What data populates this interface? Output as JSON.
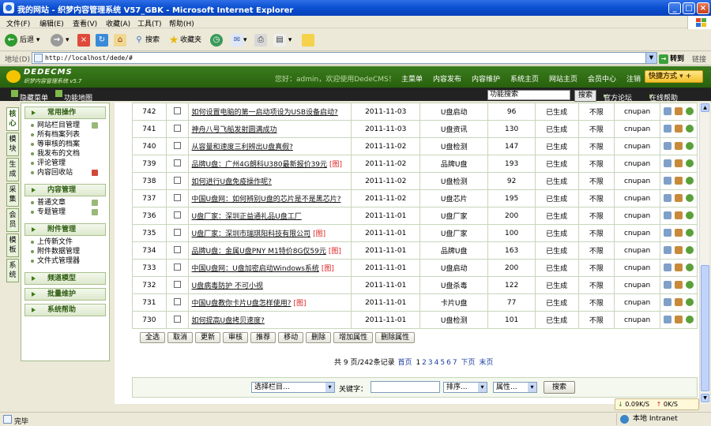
{
  "window": {
    "title": "我的网站 - 织梦内容管理系统 V57_GBK - Microsoft Internet Explorer",
    "min": "_",
    "max": "□",
    "close": "×"
  },
  "menu": [
    "文件(F)",
    "编辑(E)",
    "查看(V)",
    "收藏(A)",
    "工具(T)",
    "帮助(H)"
  ],
  "toolbar": {
    "back": "后退",
    "search": "搜索",
    "favorites": "收藏夹"
  },
  "address": {
    "label": "地址(D)",
    "url": "http://localhost/dede/#",
    "go": "转到",
    "links": "链接"
  },
  "header": {
    "logo": "DEDECMS",
    "logo_sub": "织梦内容管理系统 v5.7",
    "welcome": "您好：admin，欢迎使用DedeCMS！",
    "nav": [
      "主菜单",
      "内容发布",
      "内容维护",
      "系统主页",
      "网站主页",
      "会员中心",
      "注销"
    ],
    "quick": "快捷方式"
  },
  "subbar": {
    "hide_menu": "隐藏菜单",
    "sitemap": "功能地图",
    "search_value": "功能搜索",
    "search_button": "搜索",
    "forum": "官方论坛",
    "help": "在线帮助"
  },
  "side_tabs": [
    "核心",
    "模块",
    "生成",
    "采集",
    "会员",
    "模板",
    "系统"
  ],
  "side_menu": {
    "common": {
      "title": "常用操作",
      "items": [
        "网站栏目管理",
        "所有档案列表",
        "等审核的档案",
        "我发布的文档",
        "评论管理",
        "内容回收站"
      ]
    },
    "content": {
      "title": "内容管理",
      "items": [
        "普通文章",
        "专题管理"
      ]
    },
    "attach": {
      "title": "附件管理",
      "items": [
        "上传新文件",
        "附件数据管理",
        "文件式管理器"
      ]
    },
    "channel": {
      "title": "频道模型"
    },
    "batch": {
      "title": "批量维护"
    },
    "help": {
      "title": "系统帮助"
    }
  },
  "table": {
    "rows": [
      {
        "id": "742",
        "title": "如何设置电脑的第一启动项设为USB设备启动?",
        "img": "",
        "date": "2011-11-03",
        "category": "U盘启动",
        "clicks": "96",
        "status": "已生成",
        "flag": "不限",
        "author": "cnupan"
      },
      {
        "id": "741",
        "title": "神舟八号飞船发射圆满成功",
        "img": "",
        "date": "2011-11-03",
        "category": "U盘资讯",
        "clicks": "130",
        "status": "已生成",
        "flag": "不限",
        "author": "cnupan"
      },
      {
        "id": "740",
        "title": "从容量和速度三利辨出U盘真假?",
        "img": "",
        "date": "2011-11-02",
        "category": "U盘检测",
        "clicks": "147",
        "status": "已生成",
        "flag": "不限",
        "author": "cnupan"
      },
      {
        "id": "739",
        "title": "品牌U盘：广州4G朗科U380最新报价39元",
        "img": "[图]",
        "date": "2011-11-02",
        "category": "品牌U盘",
        "clicks": "193",
        "status": "已生成",
        "flag": "不限",
        "author": "cnupan"
      },
      {
        "id": "738",
        "title": "如何进行U盘免疫操作呢?",
        "img": "",
        "date": "2011-11-02",
        "category": "U盘检测",
        "clicks": "92",
        "status": "已生成",
        "flag": "不限",
        "author": "cnupan"
      },
      {
        "id": "737",
        "title": "中国U盘网：如何辨别U盘的芯片是不是黑芯片?",
        "img": "",
        "date": "2011-11-02",
        "category": "U盘芯片",
        "clicks": "195",
        "status": "已生成",
        "flag": "不限",
        "author": "cnupan"
      },
      {
        "id": "736",
        "title": "U盘厂家：深圳正益通礼品U盘工厂",
        "img": "",
        "date": "2011-11-01",
        "category": "U盘厂家",
        "clicks": "200",
        "status": "已生成",
        "flag": "不限",
        "author": "cnupan"
      },
      {
        "id": "735",
        "title": "U盘厂家：深圳市瑞琪阳科技有限公司",
        "img": "[图]",
        "date": "2011-11-01",
        "category": "U盘厂家",
        "clicks": "100",
        "status": "已生成",
        "flag": "不限",
        "author": "cnupan"
      },
      {
        "id": "734",
        "title": "品牌U盘：金属U盘PNY M1特价8G仅59元",
        "img": "[图]",
        "date": "2011-11-01",
        "category": "品牌U盘",
        "clicks": "163",
        "status": "已生成",
        "flag": "不限",
        "author": "cnupan"
      },
      {
        "id": "733",
        "title": "中国U盘网：U盘加密启动Windows系统",
        "img": "[图]",
        "date": "2011-11-01",
        "category": "U盘启动",
        "clicks": "200",
        "status": "已生成",
        "flag": "不限",
        "author": "cnupan"
      },
      {
        "id": "732",
        "title": "U盘病毒防护 不可小视",
        "img": "",
        "date": "2011-11-01",
        "category": "U盘杀毒",
        "clicks": "122",
        "status": "已生成",
        "flag": "不限",
        "author": "cnupan"
      },
      {
        "id": "731",
        "title": "中国U盘教你卡片U盘怎样使用?",
        "img": "[图]",
        "date": "2011-11-01",
        "category": "卡片U盘",
        "clicks": "77",
        "status": "已生成",
        "flag": "不限",
        "author": "cnupan"
      },
      {
        "id": "730",
        "title": "如何提高U盘拷贝速度?",
        "img": "",
        "date": "2011-11-01",
        "category": "U盘检测",
        "clicks": "101",
        "status": "已生成",
        "flag": "不限",
        "author": "cnupan"
      }
    ]
  },
  "actions": [
    "全选",
    "取消",
    "更新",
    "审核",
    "推荐",
    "移动",
    "删除",
    "增加属性",
    "删除属性"
  ],
  "pager": {
    "summary": "共 9 页/242条记录",
    "first": "首页",
    "pages": [
      "1",
      "2",
      "3",
      "4",
      "5",
      "6",
      "7"
    ],
    "next": "下页",
    "last": "末页"
  },
  "search": {
    "category": "选择栏目...",
    "keyword_label": "关键字：",
    "keyword_value": "",
    "sort": "排序...",
    "attr": "属性...",
    "button": "搜索"
  },
  "speed": {
    "down": "0.09K/S",
    "up": "0K/S"
  },
  "status": {
    "done": "完毕",
    "zone": "本地 Intranet"
  }
}
